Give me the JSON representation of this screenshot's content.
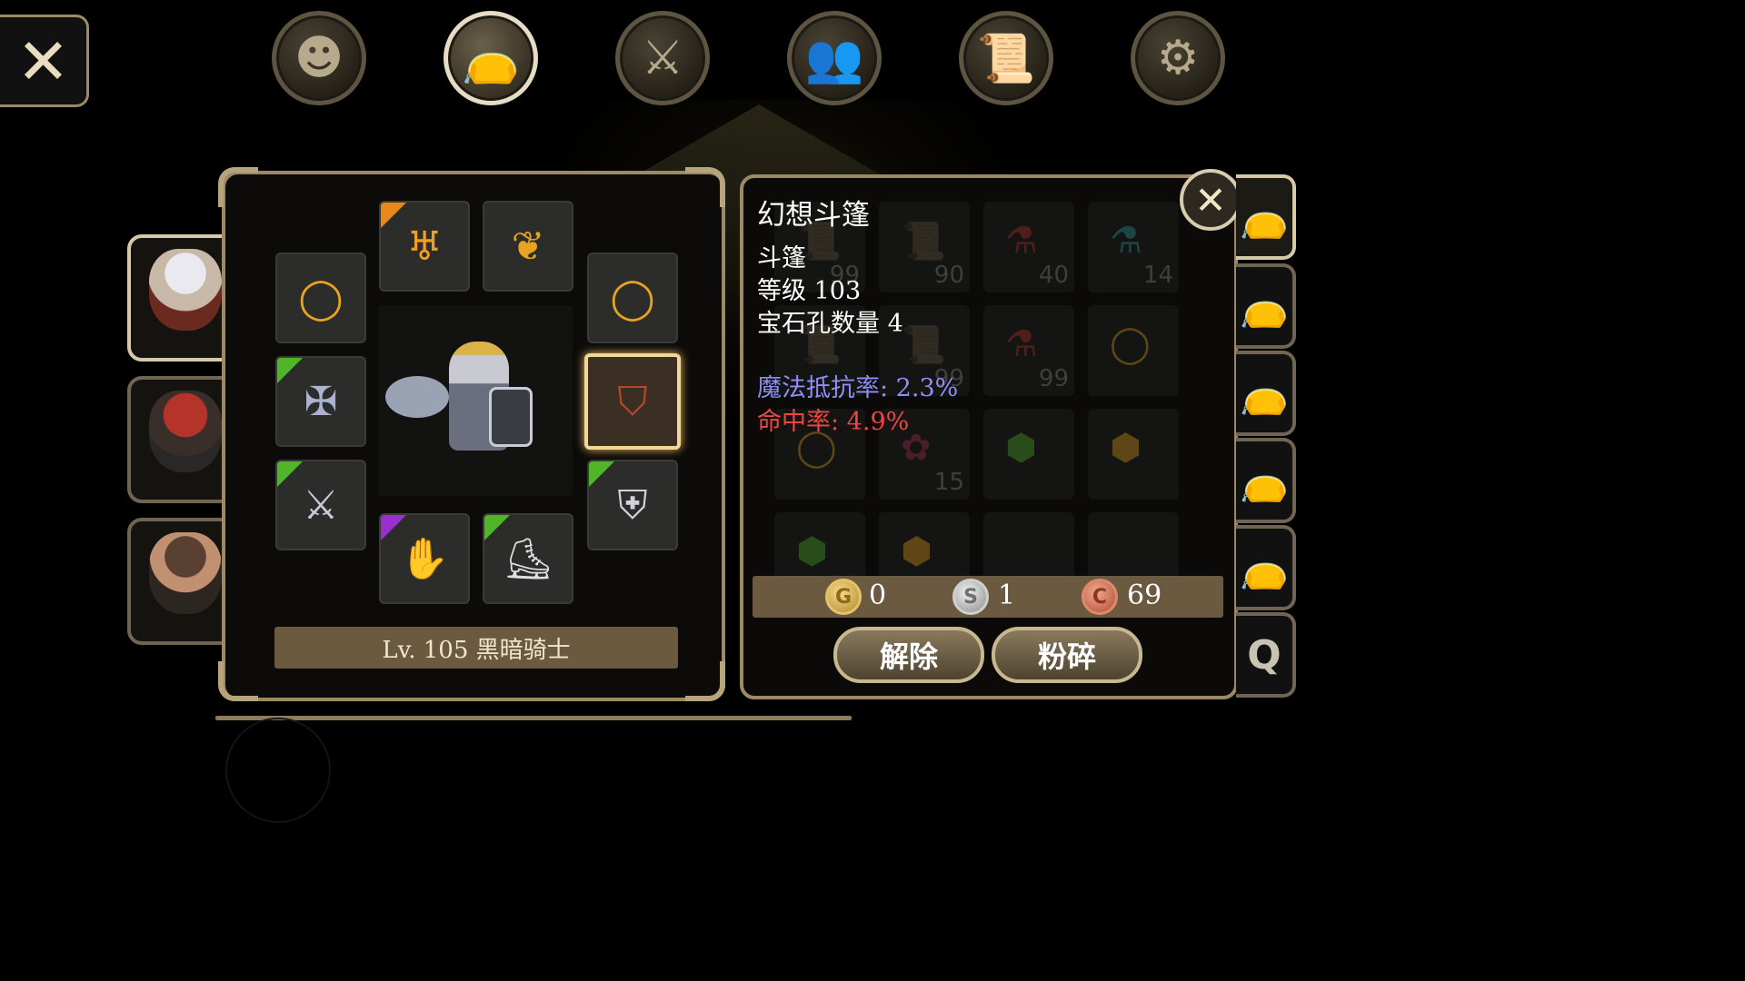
{
  "close_label": "✕",
  "nav": [
    {
      "icon": "head-silhouette-icon"
    },
    {
      "icon": "bag-icon",
      "active": true
    },
    {
      "icon": "sword-compass-icon"
    },
    {
      "icon": "party-icon"
    },
    {
      "icon": "quest-scroll-icon"
    },
    {
      "icon": "gear-icon"
    }
  ],
  "characters": [
    {
      "name": "silver-hair-hero",
      "active": true
    },
    {
      "name": "red-hair-masked"
    },
    {
      "name": "brown-hair-rogue"
    }
  ],
  "equipment": {
    "level_label": "Lv. 105 黑暗骑士",
    "slots": [
      {
        "icon": "ring-icon",
        "glyph": "◯"
      },
      {
        "icon": "horn-crown-icon",
        "glyph": "♅",
        "rarity": "#e58a1a"
      },
      {
        "icon": "necklace-icon",
        "glyph": "❦"
      },
      {
        "icon": "ring-icon",
        "glyph": "◯"
      },
      {
        "icon": "winged-armor-icon",
        "glyph": "✠",
        "rarity": "#4fb62a"
      },
      {
        "icon": "cloak-icon",
        "glyph": "⛉",
        "selected": true
      },
      {
        "icon": "axe-icon",
        "glyph": "⚔",
        "rarity": "#4fb62a"
      },
      {
        "icon": "shield-icon",
        "glyph": "⛨",
        "rarity": "#4fb62a"
      },
      {
        "icon": "gauntlet-icon",
        "glyph": "✋",
        "rarity": "#9a2fcf"
      },
      {
        "icon": "boot-icon",
        "glyph": "⛸",
        "rarity": "#4fb62a"
      }
    ]
  },
  "item": {
    "name": "幻想斗篷",
    "type": "斗篷",
    "level": "等级 103",
    "sockets": "宝石孔数量 4",
    "stat1": "魔法抵抗率: 2.3%",
    "stat2": "命中率: 4.9%",
    "close_label": "✕"
  },
  "inventory_ghost": [
    {
      "count": "99"
    },
    {
      "count": "90"
    },
    {
      "count": "40"
    },
    {
      "count": "14"
    },
    {
      "count": ""
    },
    {
      "count": "99"
    },
    {
      "count": "99"
    },
    {
      "count": ""
    },
    {
      "count": ""
    },
    {
      "count": "15"
    },
    {
      "count": ""
    },
    {
      "count": ""
    },
    {
      "count": ""
    },
    {
      "count": ""
    },
    {
      "count": ""
    },
    {
      "count": ""
    }
  ],
  "currency": {
    "gold_symbol": "G",
    "gold": "0",
    "silver_symbol": "S",
    "silver": "1",
    "copper_symbol": "C",
    "copper": "69"
  },
  "actions": {
    "unequip": "解除",
    "smash": "粉碎"
  },
  "inventory_tabs": [
    {
      "icon": "bag-icon",
      "active": true
    },
    {
      "icon": "bag-icon"
    },
    {
      "icon": "bag-icon"
    },
    {
      "icon": "bag-icon"
    },
    {
      "icon": "bag-icon"
    },
    {
      "icon": "quest-bag-icon",
      "glyph": "Q"
    }
  ],
  "colors": {
    "frame": "#9c8a66",
    "bar": "#6b5a40",
    "stat_blue": "#8e8ef5",
    "stat_red": "#f04545",
    "selected_glow": "#f2d79a"
  }
}
